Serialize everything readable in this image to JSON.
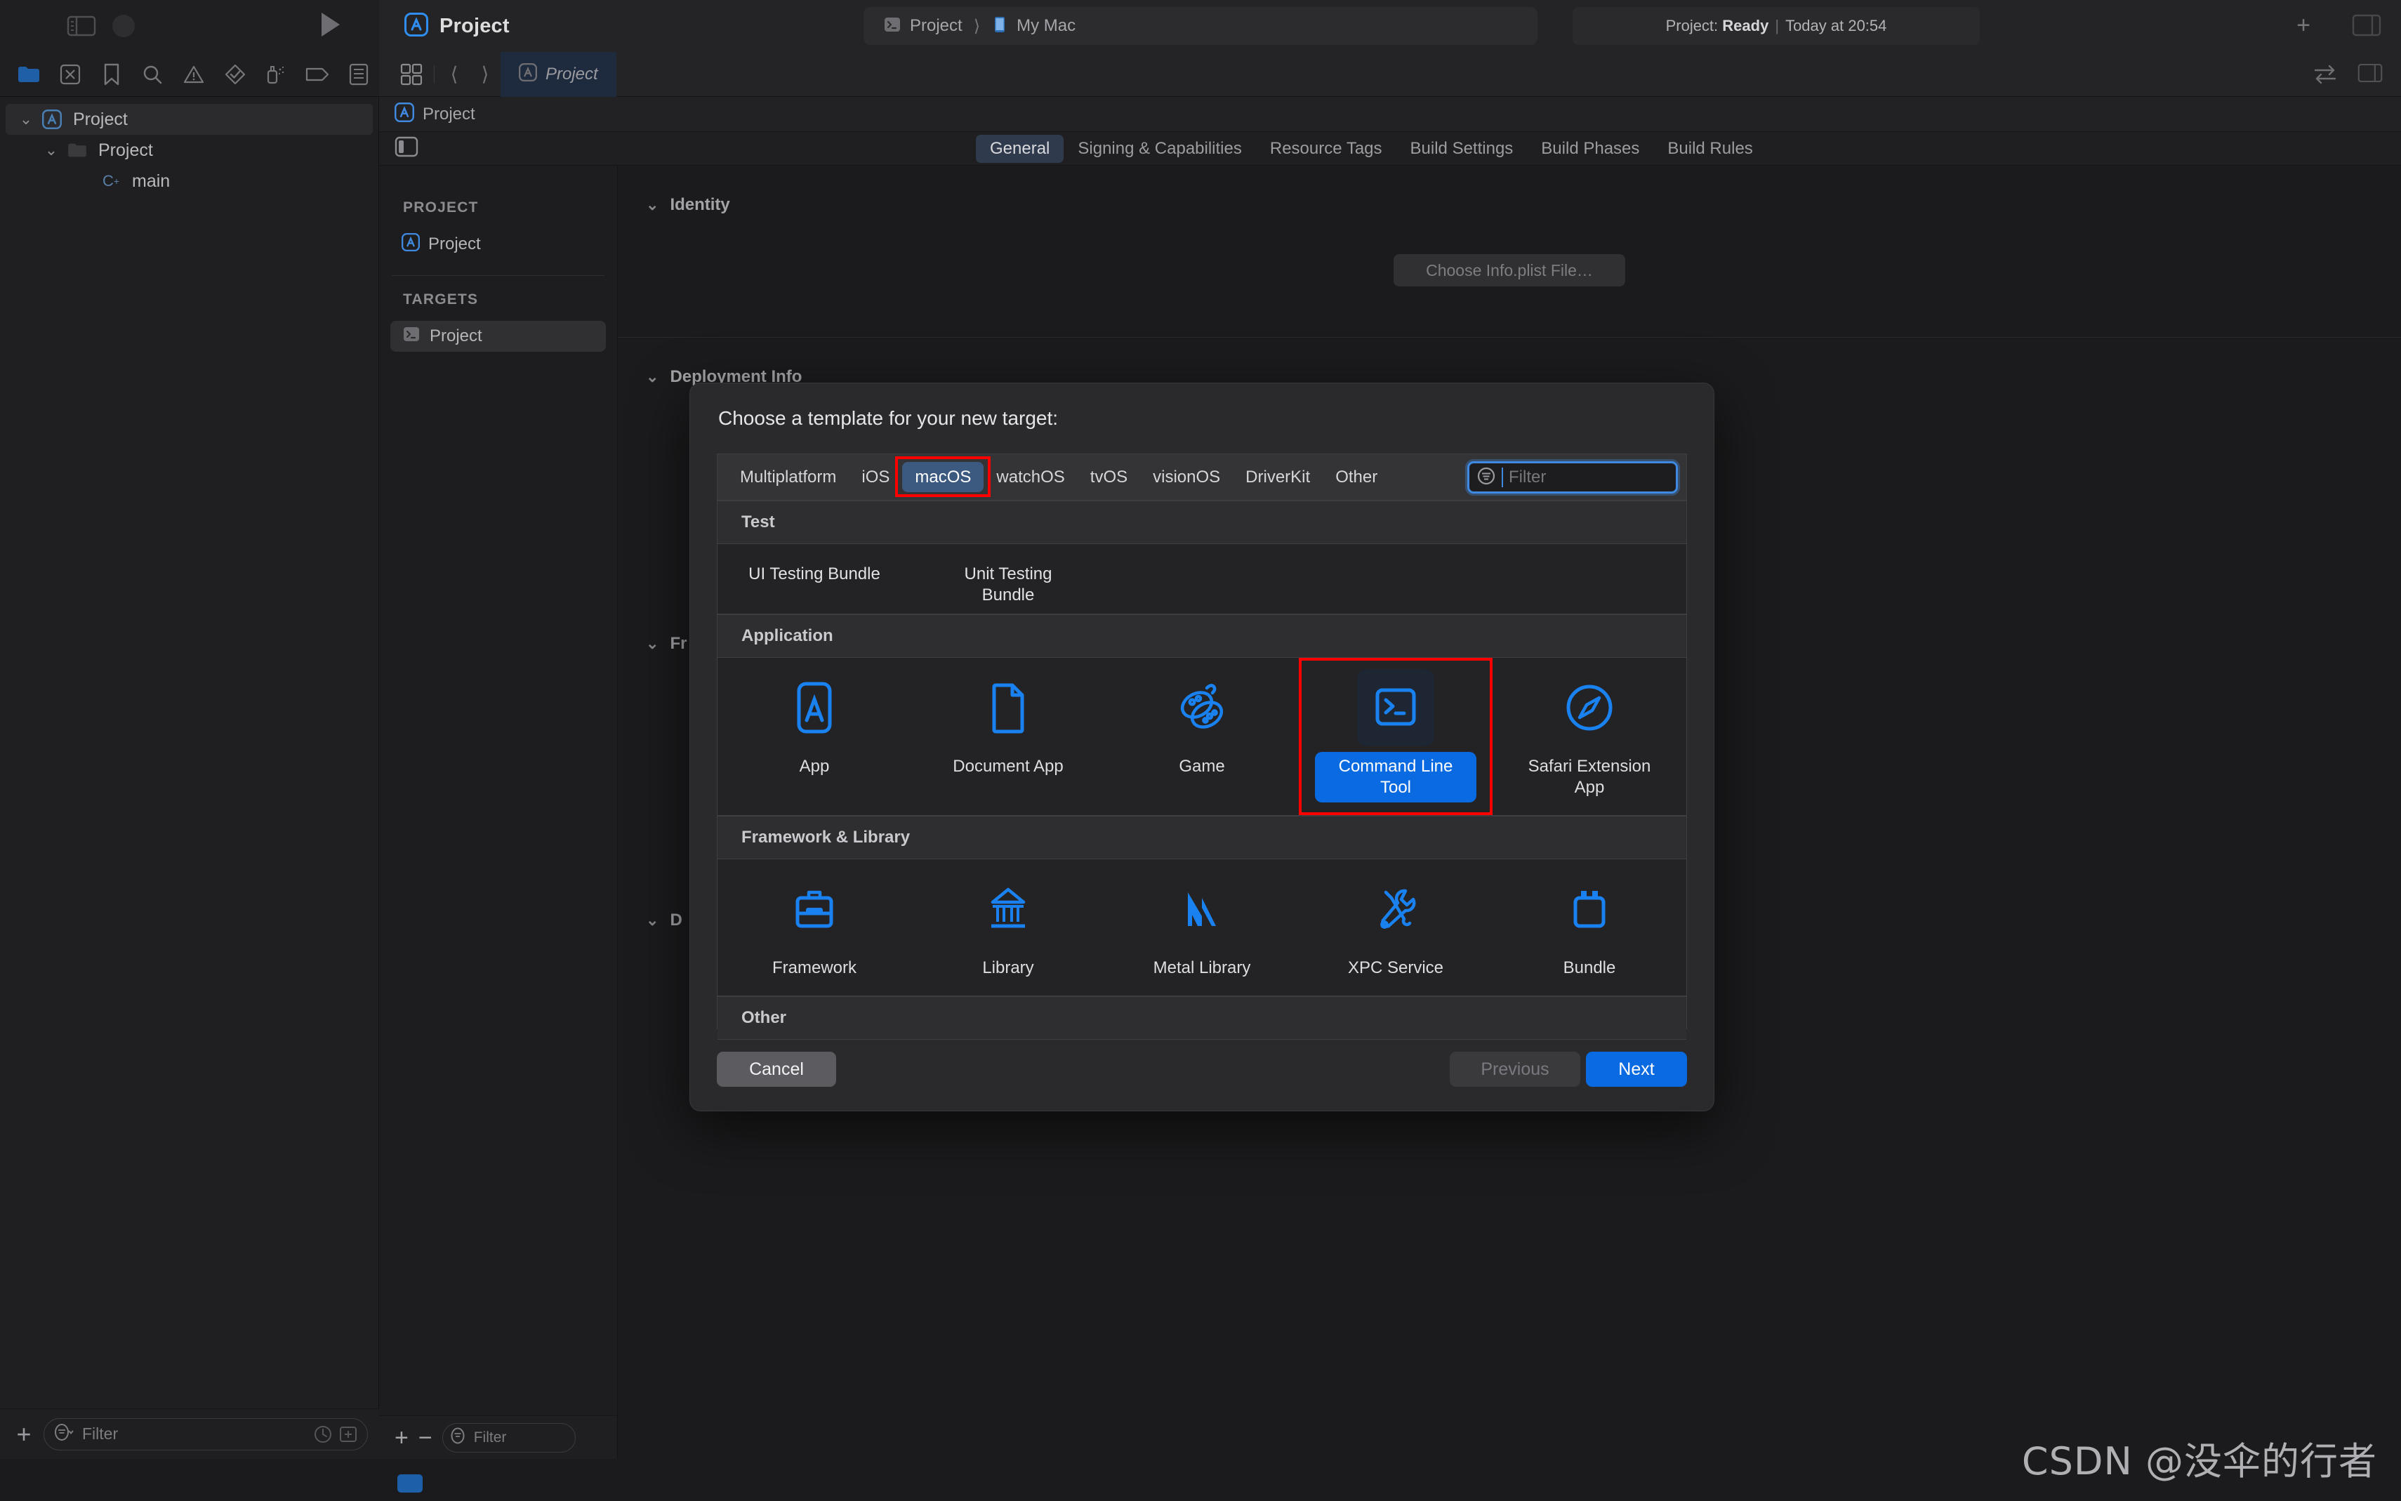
{
  "app": {
    "project_name": "Project",
    "status_prefix": "Project:",
    "status_state": "Ready",
    "status_time": "Today at 20:54",
    "scheme": "Project",
    "destination": "My Mac"
  },
  "navigator": {
    "icons": [
      "folder-icon",
      "source-control-icon",
      "bookmark-icon",
      "search-icon",
      "warning-icon",
      "test-icon",
      "debug-icon",
      "breakpoint-icon",
      "report-icon"
    ],
    "tree": [
      {
        "label": "Project",
        "depth": 0,
        "icon": "xcode-app-icon",
        "chevron": "⌄",
        "selected": true
      },
      {
        "label": "Project",
        "depth": 1,
        "icon": "folder-icon",
        "chevron": "⌄",
        "selected": false
      },
      {
        "label": "main",
        "depth": 2,
        "icon": "cpp-file-icon",
        "chevron": "",
        "selected": false
      }
    ],
    "filter_placeholder": "Filter"
  },
  "editor_bar": {
    "tab_label": "Project"
  },
  "project_editor": {
    "header_label": "Project",
    "tabs": [
      {
        "label": "General",
        "active": true
      },
      {
        "label": "Signing & Capabilities",
        "active": false
      },
      {
        "label": "Resource Tags",
        "active": false
      },
      {
        "label": "Build Settings",
        "active": false
      },
      {
        "label": "Build Phases",
        "active": false
      },
      {
        "label": "Build Rules",
        "active": false
      }
    ],
    "sidebar": {
      "project_group": "PROJECT",
      "project_items": [
        {
          "label": "Project",
          "icon": "xcode-app-icon"
        }
      ],
      "targets_group": "TARGETS",
      "target_items": [
        {
          "label": "Project",
          "icon": "terminal-icon",
          "selected": true
        }
      ]
    },
    "sections": [
      {
        "label": "Identity",
        "chevron": "⌄"
      },
      {
        "label": "Deployment Info",
        "chevron": "⌄"
      },
      {
        "label": "Fr",
        "chevron": "⌄"
      },
      {
        "label": "D",
        "chevron": "⌄"
      }
    ],
    "choose_plist_label": "Choose Info.plist File…",
    "filter_placeholder": "Filter",
    "add_symbol": "+",
    "remove_symbol": "−"
  },
  "dialog": {
    "title": "Choose a template for your new target:",
    "platform_tabs": [
      {
        "label": "Multiplatform",
        "active": false
      },
      {
        "label": "iOS",
        "active": false
      },
      {
        "label": "macOS",
        "active": true,
        "highlighted": true
      },
      {
        "label": "watchOS",
        "active": false
      },
      {
        "label": "tvOS",
        "active": false
      },
      {
        "label": "visionOS",
        "active": false
      },
      {
        "label": "DriverKit",
        "active": false
      },
      {
        "label": "Other",
        "active": false
      }
    ],
    "filter_placeholder": "Filter",
    "sections": [
      {
        "title": "Test",
        "text_only": true,
        "items": [
          {
            "label": "UI Testing Bundle",
            "icon": "",
            "selected": false
          },
          {
            "label": "Unit Testing Bundle",
            "icon": "",
            "selected": false
          },
          {
            "label": "",
            "icon": "",
            "selected": false
          },
          {
            "label": "",
            "icon": "",
            "selected": false
          },
          {
            "label": "",
            "icon": "",
            "selected": false
          }
        ]
      },
      {
        "title": "Application",
        "text_only": false,
        "items": [
          {
            "label": "App",
            "icon": "app-store-icon",
            "selected": false
          },
          {
            "label": "Document App",
            "icon": "document-icon",
            "selected": false
          },
          {
            "label": "Game",
            "icon": "game-controller-icon",
            "selected": false
          },
          {
            "label": "Command Line Tool",
            "icon": "terminal-icon",
            "selected": true,
            "highlighted": true
          },
          {
            "label": "Safari Extension App",
            "icon": "safari-compass-icon",
            "selected": false
          }
        ]
      },
      {
        "title": "Framework & Library",
        "text_only": false,
        "items": [
          {
            "label": "Framework",
            "icon": "toolbox-icon",
            "selected": false
          },
          {
            "label": "Library",
            "icon": "bank-columns-icon",
            "selected": false
          },
          {
            "label": "Metal Library",
            "icon": "metal-m-icon",
            "selected": false
          },
          {
            "label": "XPC Service",
            "icon": "wrench-screwdriver-icon",
            "selected": false
          },
          {
            "label": "Bundle",
            "icon": "bundle-box-icon",
            "selected": false
          }
        ]
      },
      {
        "title": "Other",
        "text_only": false,
        "items": []
      }
    ],
    "buttons": {
      "cancel": "Cancel",
      "previous": "Previous",
      "next": "Next"
    }
  },
  "watermark": {
    "text": "CSDN @没伞的行者"
  },
  "colors": {
    "accent_blue": "#0a6ae1",
    "icon_blue": "#1a82f0",
    "highlight_red": "#ff0000",
    "tab_active_blue": "#3c5a80",
    "window_bg": "#1b1b1d"
  }
}
